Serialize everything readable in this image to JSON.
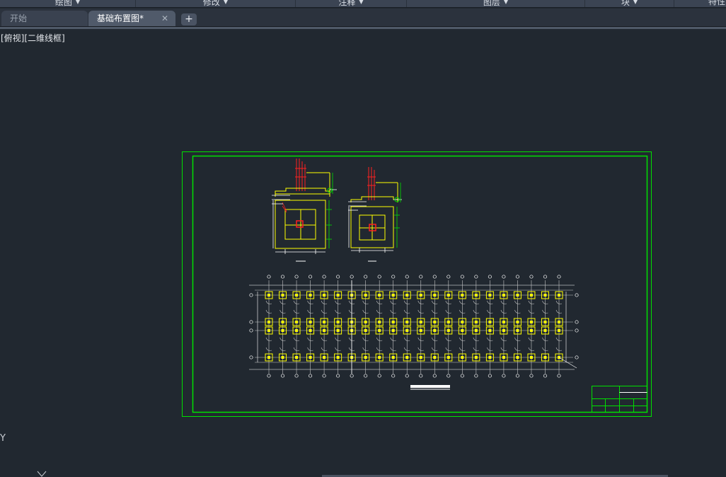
{
  "ribbon": {
    "panels": [
      {
        "label": "绘图"
      },
      {
        "label": "修改"
      },
      {
        "label": "注释"
      },
      {
        "label": "图层"
      },
      {
        "label": "块"
      },
      {
        "label": "特性"
      }
    ]
  },
  "tabs": {
    "start": "开始",
    "drawing": "基础布置图*",
    "close_glyph": "✕",
    "new_glyph": "+"
  },
  "viewport": {
    "label": "[俯视][二维线框]"
  },
  "ucs": {
    "y_label": "Y"
  },
  "colors": {
    "background": "#212830",
    "frame": "#00e000",
    "footing": "#ffff00",
    "column": "#ff2020",
    "dims": "#ffffff",
    "grid": "#c8c8c8"
  }
}
